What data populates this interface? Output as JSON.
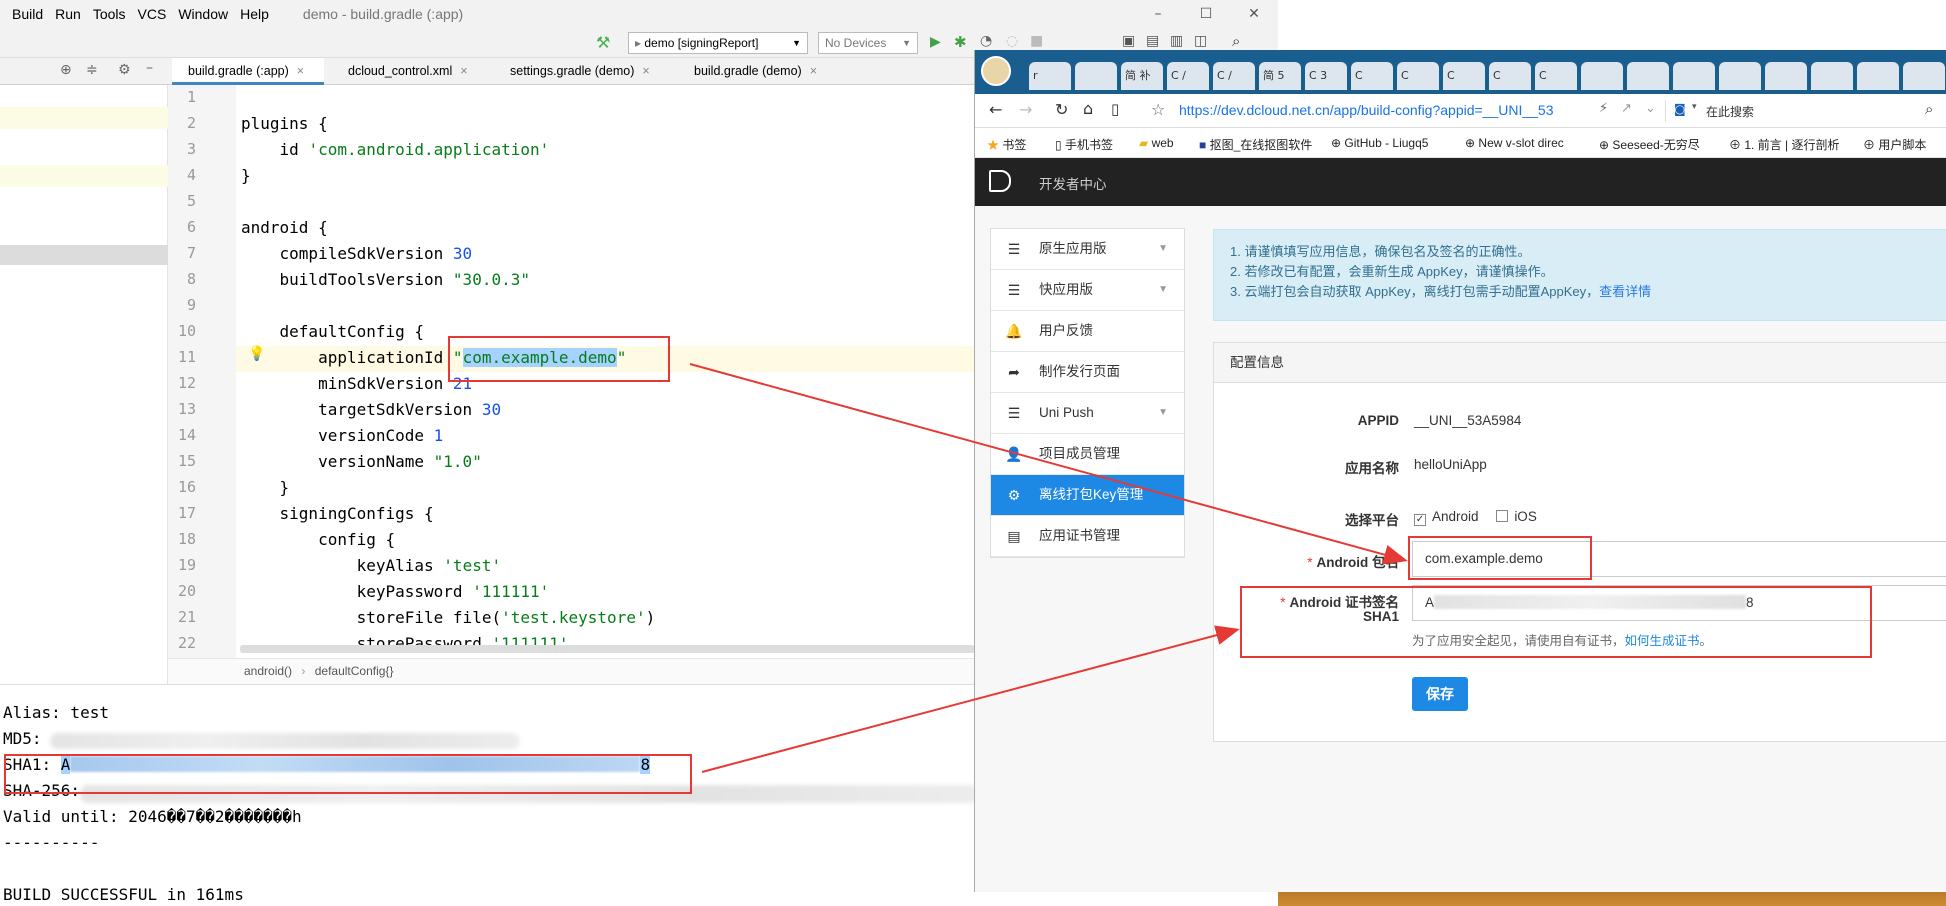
{
  "ide": {
    "menu": [
      "Build",
      "Run",
      "Tools",
      "VCS",
      "Window",
      "Help"
    ],
    "window_title": "demo - build.gradle (:app)",
    "window_controls": [
      "–",
      "☐",
      "✕"
    ],
    "run_config": "demo [signingReport]",
    "device": "No Devices",
    "tabs": [
      "build.gradle (:app)",
      "dcloud_control.xml",
      "settings.gradle (demo)",
      "build.gradle (demo)"
    ],
    "line_numbers": [
      "1",
      "2",
      "3",
      "4",
      "5",
      "6",
      "7",
      "8",
      "9",
      "10",
      "11",
      "12",
      "13",
      "14",
      "15",
      "16",
      "17",
      "18",
      "19",
      "20",
      "21",
      "22"
    ],
    "code": {
      "l2": "plugins {",
      "l3_kw": "    id ",
      "l3_str": "'com.android.application'",
      "l4": "}",
      "l6": "android {",
      "l7_kw": "    compileSdkVersion ",
      "l7_num": "30",
      "l8_kw": "    buildToolsVersion ",
      "l8_str": "\"30.0.3\"",
      "l10": "    defaultConfig {",
      "l11_kw": "        applicationId ",
      "l11_q1": "\"",
      "l11_sel": "com.example.demo",
      "l11_q2": "\"",
      "l12_kw": "        minSdkVersion ",
      "l12_num": "21",
      "l13_kw": "        targetSdkVersion ",
      "l13_num": "30",
      "l14_kw": "        versionCode ",
      "l14_num": "1",
      "l15_kw": "        versionName ",
      "l15_str": "\"1.0\"",
      "l16": "    }",
      "l17": "    signingConfigs {",
      "l18": "        config {",
      "l19_kw": "            keyAlias ",
      "l19_str": "'test'",
      "l20_kw": "            keyPassword ",
      "l20_str": "'111111'",
      "l21_kw": "            storeFile file(",
      "l21_str": "'test.keystore'",
      "l21_end": ")",
      "l22_kw": "            storePassword ",
      "l22_str": "'111111'"
    },
    "breadcrumb": [
      "android()",
      "defaultConfig{}"
    ],
    "console": {
      "alias": "Alias: test",
      "md5": "MD5:",
      "sha1_label": "SHA1: ",
      "sha1_start": "A",
      "sha1_end": "8",
      "sha256": "SHA-256:",
      "valid": "Valid until: 2046��7��2�������h",
      "sep": "----------",
      "build": "BUILD SUCCESSFUL in 161ms"
    }
  },
  "browser": {
    "url": "https://dev.dcloud.net.cn/app/build-config?appid=__UNI__53",
    "search_placeholder": "在此搜索",
    "tabs": [
      "r",
      "",
      "简 补",
      "C /",
      "C /",
      "简 5",
      "C 3",
      "C",
      "C",
      "C",
      "C",
      "C",
      "",
      "",
      "",
      "",
      "",
      "",
      "",
      ""
    ],
    "bookmarks": [
      "书签",
      "手机书签",
      "web",
      "抠图_在线抠图软件",
      "GitHub - Liugq5",
      "New v-slot direc",
      "Seeseed-无穷尽",
      "1. 前言 | 逐行剖析",
      "用户脚本"
    ],
    "site_title": "开发者中心",
    "nav": [
      {
        "label": "原生应用版",
        "icon": "list-icon",
        "has_caret": true
      },
      {
        "label": "快应用版",
        "icon": "list-icon",
        "has_caret": true
      },
      {
        "label": "用户反馈",
        "icon": "bell-icon",
        "has_caret": false
      },
      {
        "label": "制作发行页面",
        "icon": "share-icon",
        "has_caret": false
      },
      {
        "label": "Uni Push",
        "icon": "list-icon",
        "has_caret": true
      },
      {
        "label": "项目成员管理",
        "icon": "user-icon",
        "has_caret": false
      },
      {
        "label": "离线打包Key管理",
        "icon": "gear-icon",
        "has_caret": false,
        "active": true
      },
      {
        "label": "应用证书管理",
        "icon": "th-list-icon",
        "has_caret": false
      }
    ],
    "alert": {
      "line1": "1. 请谨慎填写应用信息，确保包名及签名的正确性。",
      "line2": "2. 若修改已有配置，会重新生成 AppKey，请谨慎操作。",
      "line3": "3. 云端打包会自动获取 AppKey，离线打包需手动配置AppKey，",
      "link": "查看详情"
    },
    "panel_title": "配置信息",
    "form": {
      "appid_label": "APPID",
      "appid_value": "__UNI__53A5984",
      "appname_label": "应用名称",
      "appname_value": "helloUniApp",
      "platform_label": "选择平台",
      "platform_android": "Android",
      "platform_ios": "iOS",
      "android_checked": true,
      "ios_checked": false,
      "pkg_label": "Android 包名",
      "pkg_value": "com.example.demo",
      "sha1_label_1": "Android 证书签名",
      "sha1_label_2": "SHA1",
      "sha1_start": "A",
      "sha1_end": "8",
      "hint": "为了应用安全起见，请使用自有证书，",
      "hint_link": "如何生成证书",
      "hint_end": "。",
      "save": "保存"
    }
  },
  "annotation_color": "#e53935"
}
